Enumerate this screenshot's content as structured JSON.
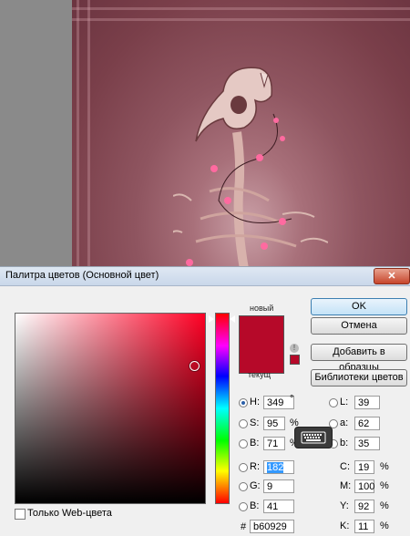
{
  "dialog": {
    "title": "Палитра цветов (Основной цвет)",
    "close_icon": "close-icon"
  },
  "swatch": {
    "new_label": "новый",
    "current_label": "текущ",
    "color": "#b60929",
    "warning_icon": "out-of-gamut-warning-icon"
  },
  "buttons": {
    "ok": "OK",
    "cancel": "Отмена",
    "add_to_swatches": "Добавить в образцы",
    "color_libraries": "Библиотеки цветов"
  },
  "hsb": {
    "h": {
      "label": "H:",
      "value": "349",
      "unit": "°"
    },
    "s": {
      "label": "S:",
      "value": "95",
      "unit": "%"
    },
    "b": {
      "label": "B:",
      "value": "71",
      "unit": "%"
    }
  },
  "rgb": {
    "r": {
      "label": "R:",
      "value": "182"
    },
    "g": {
      "label": "G:",
      "value": "9"
    },
    "b": {
      "label": "B:",
      "value": "41"
    }
  },
  "lab": {
    "l": {
      "label": "L:",
      "value": "39"
    },
    "a": {
      "label": "a:",
      "value": "62"
    },
    "b": {
      "label": "b:",
      "value": "35"
    }
  },
  "cmyk": {
    "c": {
      "label": "C:",
      "value": "19",
      "unit": "%"
    },
    "m": {
      "label": "M:",
      "value": "100",
      "unit": "%"
    },
    "y": {
      "label": "Y:",
      "value": "92",
      "unit": "%"
    },
    "k": {
      "label": "K:",
      "value": "11",
      "unit": "%"
    }
  },
  "hex": {
    "label": "#",
    "value": "b60929"
  },
  "web_only": {
    "label": "Только Web-цвета"
  },
  "keyboard_icon": "keyboard-icon"
}
